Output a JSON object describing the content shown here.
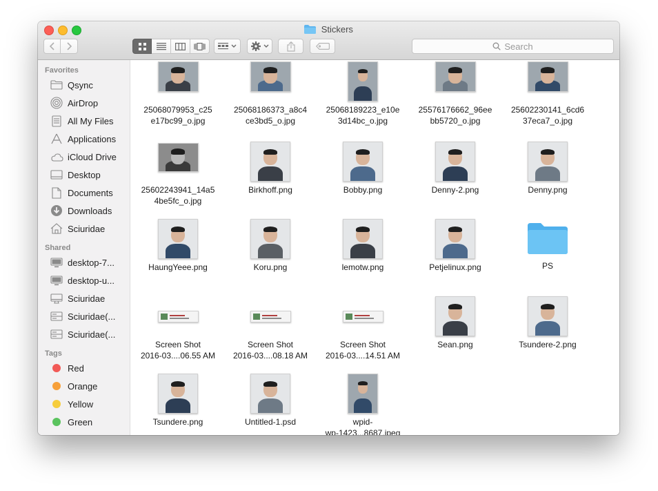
{
  "window": {
    "title": "Stickers"
  },
  "search": {
    "placeholder": "Search"
  },
  "sidebar": {
    "favorites_heading": "Favorites",
    "favorites": [
      {
        "label": "Qsync",
        "icon": "folder-icon"
      },
      {
        "label": "AirDrop",
        "icon": "airdrop-icon"
      },
      {
        "label": "All My Files",
        "icon": "all-files-icon"
      },
      {
        "label": "Applications",
        "icon": "applications-icon"
      },
      {
        "label": "iCloud Drive",
        "icon": "cloud-icon"
      },
      {
        "label": "Desktop",
        "icon": "desktop-icon"
      },
      {
        "label": "Documents",
        "icon": "documents-icon"
      },
      {
        "label": "Downloads",
        "icon": "downloads-icon"
      },
      {
        "label": "Sciuridae",
        "icon": "home-icon"
      }
    ],
    "shared_heading": "Shared",
    "shared": [
      {
        "label": "desktop-7...",
        "icon": "monitor-icon"
      },
      {
        "label": "desktop-u...",
        "icon": "monitor-icon"
      },
      {
        "label": "Sciuridae",
        "icon": "imac-icon"
      },
      {
        "label": "Sciuridae(...",
        "icon": "server-icon"
      },
      {
        "label": "Sciuridae(...",
        "icon": "server-icon"
      }
    ],
    "tags_heading": "Tags",
    "tags": [
      {
        "label": "Red",
        "color": "#f25a57"
      },
      {
        "label": "Orange",
        "color": "#f7a03a"
      },
      {
        "label": "Yellow",
        "color": "#f6cd3c"
      },
      {
        "label": "Green",
        "color": "#5ac35e"
      }
    ]
  },
  "files": [
    {
      "line1": "25068079953_c25",
      "line2": "e17bc99_o.jpg",
      "kind": "photo"
    },
    {
      "line1": "25068186373_a8c4",
      "line2": "ce3bd5_o.jpg",
      "kind": "photo"
    },
    {
      "line1": "25068189223_e10e",
      "line2": "3d14bc_o.jpg",
      "kind": "photo-tall"
    },
    {
      "line1": "25576176662_96ee",
      "line2": "bb5720_o.jpg",
      "kind": "photo"
    },
    {
      "line1": "25602230141_6cd6",
      "line2": "37eca7_o.jpg",
      "kind": "photo"
    },
    {
      "line1": "25602243941_14a5",
      "line2": "4be5fc_o.jpg",
      "kind": "photo-bw"
    },
    {
      "line1": "Birkhoff.png",
      "line2": "",
      "kind": "sticker"
    },
    {
      "line1": "Bobby.png",
      "line2": "",
      "kind": "sticker"
    },
    {
      "line1": "Denny-2.png",
      "line2": "",
      "kind": "sticker"
    },
    {
      "line1": "Denny.png",
      "line2": "",
      "kind": "sticker"
    },
    {
      "line1": "HaungYeee.png",
      "line2": "",
      "kind": "sticker"
    },
    {
      "line1": "Koru.png",
      "line2": "",
      "kind": "sticker"
    },
    {
      "line1": "lemotw.png",
      "line2": "",
      "kind": "sticker"
    },
    {
      "line1": "Petjelinux.png",
      "line2": "",
      "kind": "sticker"
    },
    {
      "line1": "PS",
      "line2": "",
      "kind": "folder"
    },
    {
      "line1": "Screen Shot",
      "line2": "2016-03....06.55 AM",
      "kind": "screenshot"
    },
    {
      "line1": "Screen Shot",
      "line2": "2016-03....08.18 AM",
      "kind": "screenshot"
    },
    {
      "line1": "Screen Shot",
      "line2": "2016-03....14.51 AM",
      "kind": "screenshot"
    },
    {
      "line1": "Sean.png",
      "line2": "",
      "kind": "sticker"
    },
    {
      "line1": "Tsundere-2.png",
      "line2": "",
      "kind": "sticker"
    },
    {
      "line1": "Tsundere.png",
      "line2": "",
      "kind": "sticker"
    },
    {
      "line1": "Untitled-1.psd",
      "line2": "",
      "kind": "sticker"
    },
    {
      "line1": "wpid-",
      "line2": "wp-1423...8687.jpeg",
      "kind": "photo-tall"
    }
  ]
}
